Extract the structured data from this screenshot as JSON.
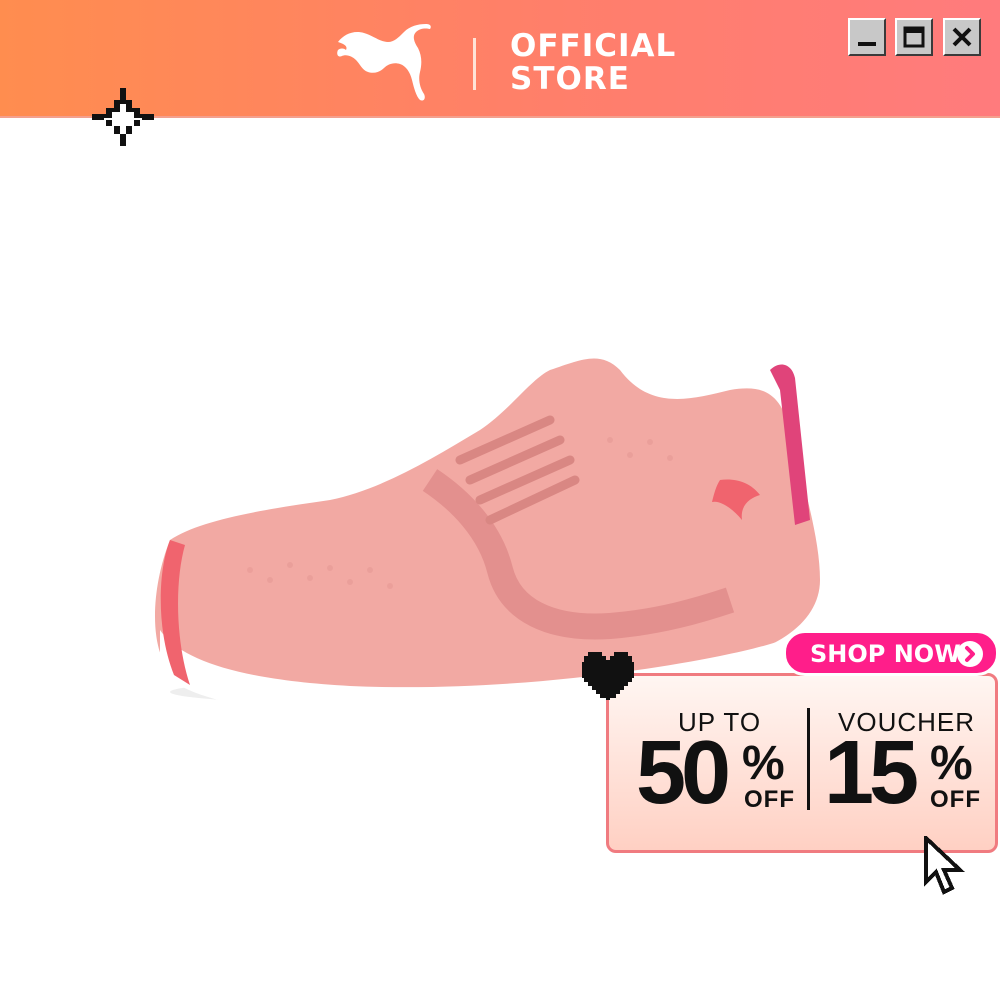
{
  "header": {
    "brand_logo": "puma-cat-logo",
    "store_line1": "OFFICIAL",
    "store_line2": "STORE",
    "background_from": "#ff8d4f",
    "background_to": "#ff7b7d"
  },
  "window_controls": {
    "minimize_icon": "minimize-icon",
    "maximize_icon": "maximize-icon",
    "close_icon": "close-icon"
  },
  "decorations": {
    "sparkle_icon": "pixel-sparkle-icon",
    "heart_icon": "pixel-heart-icon",
    "cursor_icon": "pixel-cursor-icon"
  },
  "product": {
    "image": "pink-sneaker",
    "color": "#f2a9a3",
    "accent": "#f0646e"
  },
  "promo": {
    "shop_button_label": "SHOP NOW",
    "shop_button_color": "#ff1e8a",
    "left": {
      "top_label": "UP TO",
      "value": "50",
      "percent": "%",
      "suffix": "OFF"
    },
    "right": {
      "top_label": "VOUCHER",
      "value": "15",
      "percent": "%",
      "suffix": "OFF"
    }
  }
}
